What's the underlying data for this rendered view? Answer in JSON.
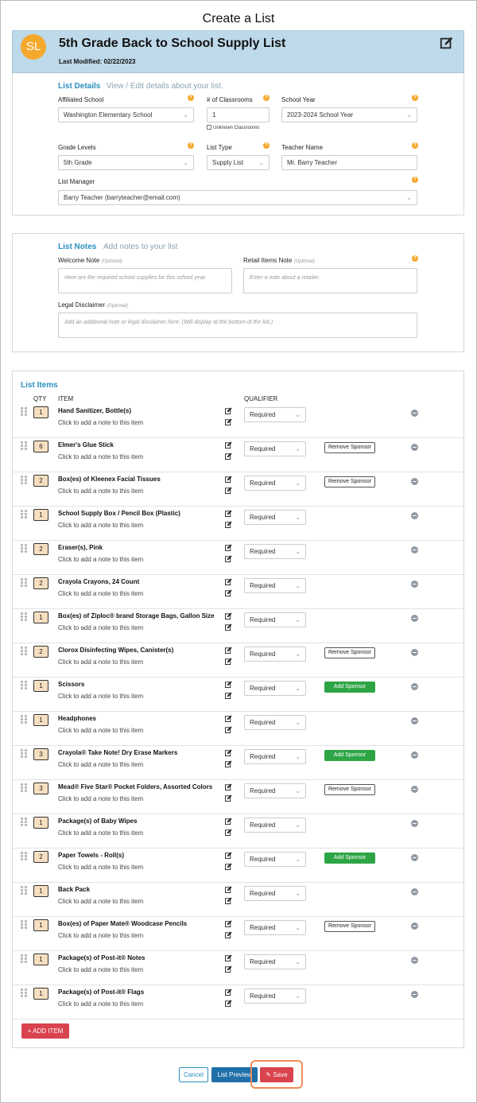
{
  "page": {
    "title": "Create a List"
  },
  "header": {
    "avatar_initials": "SL",
    "list_name": "5th Grade Back to School Supply List",
    "last_modified": "Last Modified: 02/22/2023"
  },
  "list_details": {
    "heading": "List Details",
    "subheading": "View / Edit details about your list.",
    "affiliated_school": {
      "label": "Affiliated School",
      "value": "Washington Elementary School"
    },
    "classrooms": {
      "label": "# of Classrooms",
      "value": "1",
      "unknown_label": "Unknown Classrooms"
    },
    "school_year": {
      "label": "School Year",
      "value": "2023-2024 School Year"
    },
    "grade_levels": {
      "label": "Grade Levels",
      "value": "5th Grade"
    },
    "list_type": {
      "label": "List Type",
      "value": "Supply List"
    },
    "teacher_name": {
      "label": "Teacher Name",
      "value": "Mr. Barry Teacher"
    },
    "list_manager": {
      "label": "List Manager",
      "value": "Barry Teacher (barryteacher@email.com)"
    }
  },
  "list_notes": {
    "heading": "List Notes",
    "subheading": "Add notes to your list",
    "optional": "(Optional)",
    "welcome": {
      "label": "Welcome Note",
      "placeholder": "Here are the required school supplies for this school year."
    },
    "retail": {
      "label": "Retail Items Note",
      "placeholder": "Enter a note about a retailer."
    },
    "legal": {
      "label": "Legal Disclaimer",
      "placeholder": "Add an additional note or legal disclaimer here.  (Will display at the bottom of the list.)"
    }
  },
  "list_items": {
    "heading": "List Items",
    "col_qty": "QTY",
    "col_item": "ITEM",
    "col_qualifier": "QUALIFIER",
    "note_prompt": "Click to add a note to this item",
    "add_item_label": "+ ADD ITEM",
    "items": [
      {
        "qty": "1",
        "name": "Hand Sanitizer, Bottle(s)",
        "qualifier": "Required",
        "sponsor": ""
      },
      {
        "qty": "6",
        "name": "Elmer's Glue Stick",
        "qualifier": "Required",
        "sponsor": "Remove Sponsor"
      },
      {
        "qty": "2",
        "name": "Box(es) of Kleenex Facial Tissues",
        "qualifier": "Required",
        "sponsor": "Remove Sponsor"
      },
      {
        "qty": "1",
        "name": "School Supply Box / Pencil Box (Plastic)",
        "qualifier": "Required",
        "sponsor": ""
      },
      {
        "qty": "2",
        "name": "Eraser(s), Pink",
        "qualifier": "Required",
        "sponsor": ""
      },
      {
        "qty": "2",
        "name": "Crayola Crayons, 24 Count",
        "qualifier": "Required",
        "sponsor": ""
      },
      {
        "qty": "1",
        "name": "Box(es) of Ziploc® brand Storage Bags, Gallon Size",
        "qualifier": "Required",
        "sponsor": ""
      },
      {
        "qty": "2",
        "name": "Clorox Disinfecting Wipes, Canister(s)",
        "qualifier": "Required",
        "sponsor": "Remove Sponsor"
      },
      {
        "qty": "1",
        "name": "Scissors",
        "qualifier": "Required",
        "sponsor": "Add Sponsor"
      },
      {
        "qty": "1",
        "name": "Headphones",
        "qualifier": "Required",
        "sponsor": ""
      },
      {
        "qty": "3",
        "name": "Crayola® Take Note! Dry Erase Markers",
        "qualifier": "Required",
        "sponsor": "Add Sponsor"
      },
      {
        "qty": "3",
        "name": "Mead® Five Star® Pocket Folders, Assorted Colors",
        "qualifier": "Required",
        "sponsor": "Remove Sponsor"
      },
      {
        "qty": "1",
        "name": "Package(s) of Baby Wipes",
        "qualifier": "Required",
        "sponsor": ""
      },
      {
        "qty": "2",
        "name": "Paper Towels - Roll(s)",
        "qualifier": "Required",
        "sponsor": "Add Sponsor"
      },
      {
        "qty": "1",
        "name": "Back Pack",
        "qualifier": "Required",
        "sponsor": ""
      },
      {
        "qty": "1",
        "name": "Box(es) of Paper Mate® Woodcase Pencils",
        "qualifier": "Required",
        "sponsor": "Remove Sponsor"
      },
      {
        "qty": "1",
        "name": "Package(s) of Post-it® Notes",
        "qualifier": "Required",
        "sponsor": ""
      },
      {
        "qty": "1",
        "name": "Package(s) of Post-it® Flags",
        "qualifier": "Required",
        "sponsor": ""
      }
    ]
  },
  "footer": {
    "cancel_label": "Cancel",
    "preview_label": "List Preview",
    "save_label": "Save"
  },
  "colors": {
    "accent": "#2a8fc1",
    "banner": "#bed9e9",
    "avatar": "#f4a82c",
    "danger": "#d9434e",
    "success": "#2ea545",
    "highlight": "#ef8c5b"
  }
}
